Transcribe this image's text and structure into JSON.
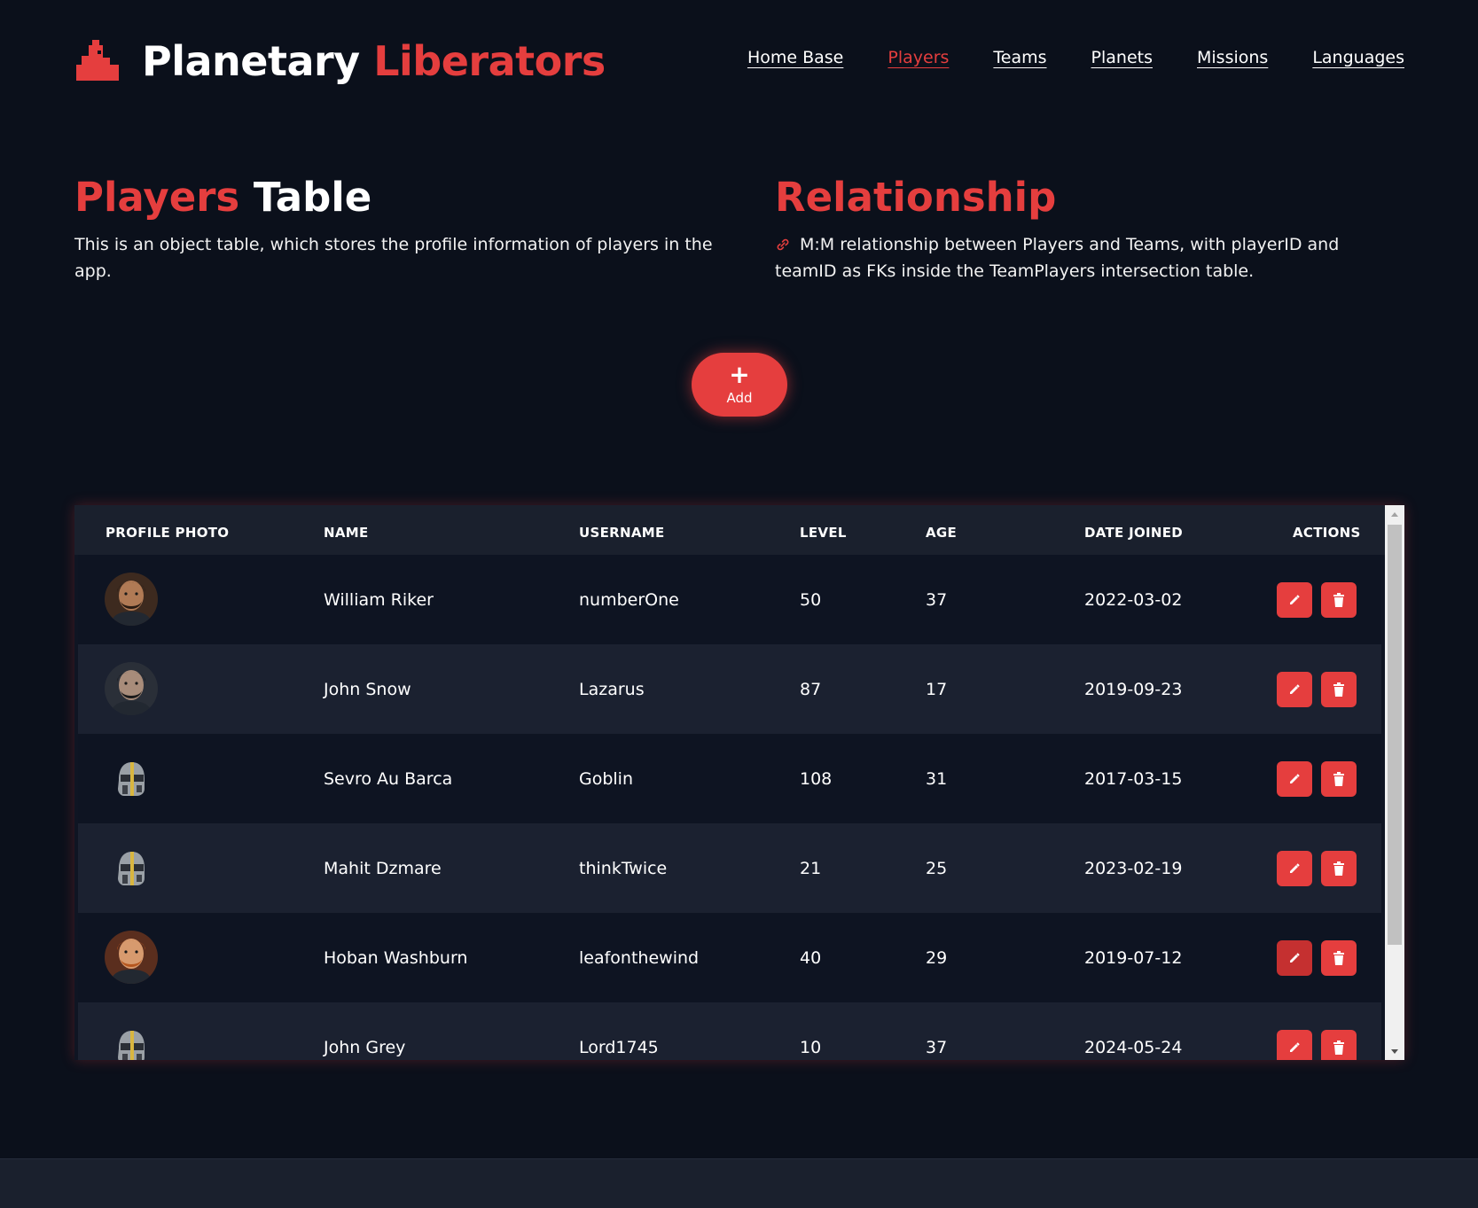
{
  "brand": {
    "word1": "Planetary",
    "word2": "Liberators",
    "accent_color": "#e53e3e",
    "icon": "rocket-castle-icon"
  },
  "nav": {
    "items": [
      {
        "label": "Home Base",
        "active": false
      },
      {
        "label": "Players",
        "active": true
      },
      {
        "label": "Teams",
        "active": false
      },
      {
        "label": "Planets",
        "active": false
      },
      {
        "label": "Missions",
        "active": false
      },
      {
        "label": "Languages",
        "active": false
      }
    ]
  },
  "players_section": {
    "title_red": "Players",
    "title_white": "Table",
    "description": "This is an object table, which stores the profile information of players in the app."
  },
  "relationship_section": {
    "title": "Relationship",
    "icon": "link-icon",
    "description": "M:M relationship between Players and Teams, with playerID and teamID as FKs inside the TeamPlayers intersection table."
  },
  "add_button": {
    "icon": "plus-icon",
    "label": "Add"
  },
  "table": {
    "columns": [
      "PROFILE PHOTO",
      "NAME",
      "USERNAME",
      "LEVEL",
      "AGE",
      "DATE JOINED",
      "ACTIONS"
    ],
    "rows": [
      {
        "photo": "face-bearded-man",
        "name": "William Riker",
        "username": "numberOne",
        "level": "50",
        "age": "37",
        "date_joined": "2022-03-02"
      },
      {
        "photo": "face-dark-hair-man",
        "name": "John Snow",
        "username": "Lazarus",
        "level": "87",
        "age": "17",
        "date_joined": "2019-09-23"
      },
      {
        "photo": "helmet-default",
        "name": "Sevro Au Barca",
        "username": "Goblin",
        "level": "108",
        "age": "31",
        "date_joined": "2017-03-15"
      },
      {
        "photo": "helmet-default",
        "name": "Mahit Dzmare",
        "username": "thinkTwice",
        "level": "21",
        "age": "25",
        "date_joined": "2023-02-19"
      },
      {
        "photo": "face-red-hair-man",
        "name": "Hoban Washburn",
        "username": "leafonthewind",
        "level": "40",
        "age": "29",
        "date_joined": "2019-07-12"
      },
      {
        "photo": "helmet-default",
        "name": "John Grey",
        "username": "Lord1745",
        "level": "10",
        "age": "37",
        "date_joined": "2024-05-24"
      }
    ],
    "edit_icon": "pencil-icon",
    "delete_icon": "trash-icon"
  }
}
